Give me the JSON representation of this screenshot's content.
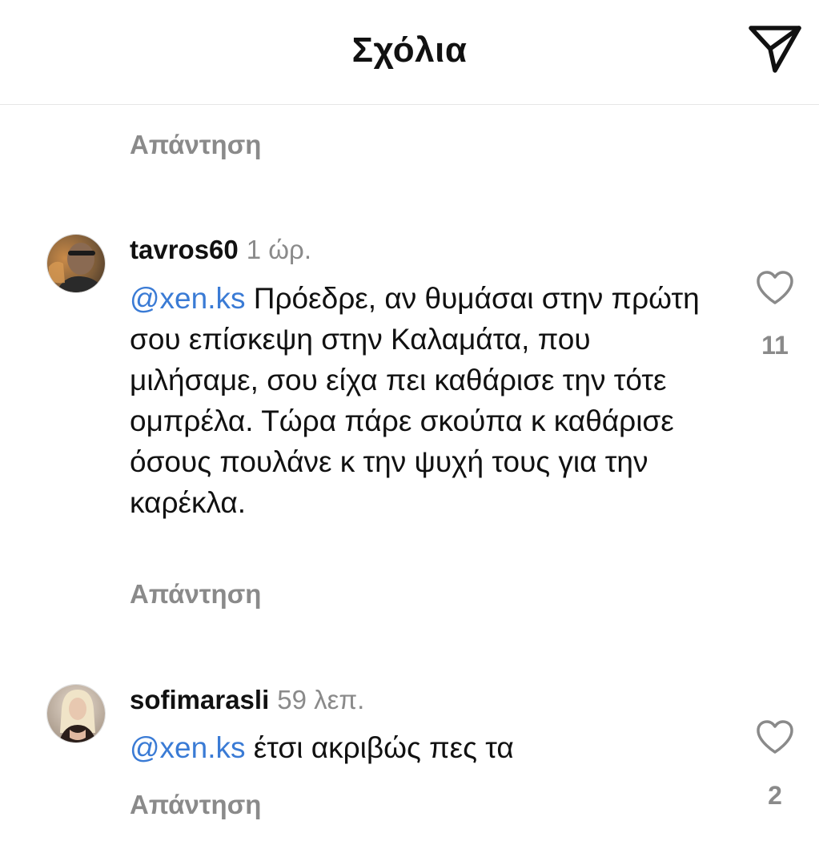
{
  "header": {
    "title": "Σχόλια",
    "share_icon": "paper-plane-icon"
  },
  "colors": {
    "mention": "#3a7bd5",
    "secondary_text": "#8a8a8a",
    "primary_text": "#111111"
  },
  "previous_comment": {
    "reply_label": "Απάντηση"
  },
  "comments": [
    {
      "username": "tavros60",
      "time": "1 ώρ.",
      "mention": "@xen.ks",
      "text": " Πρόεδρε, αν θυμάσαι στην πρώτη σου επίσκεψη στην Καλαμάτα, που μιλήσαμε, σου είχα πει καθάρισε την τότε ομπρέλα. Τώρα πάρε σκούπα κ καθάρισε όσους πουλάνε κ την ψυχή τους για την καρέκλα.",
      "likes": "11",
      "reply_label": "Απάντηση",
      "like_icon": "heart-outline-icon"
    },
    {
      "username": "sofimarasli",
      "time": "59 λεπ.",
      "mention": "@xen.ks",
      "text": " έτσι ακριβώς πες τα",
      "likes": "2",
      "reply_label": "Απάντηση",
      "like_icon": "heart-outline-icon"
    }
  ]
}
